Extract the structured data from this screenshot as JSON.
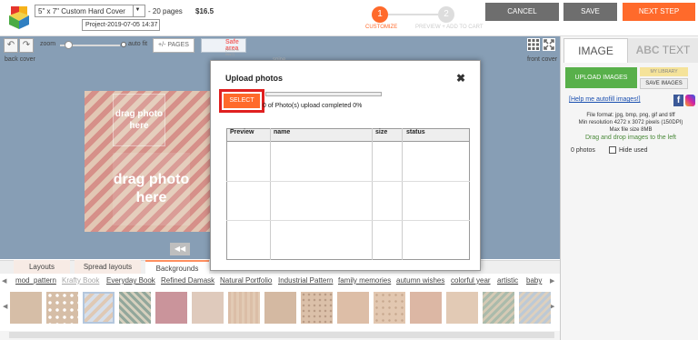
{
  "app": {
    "name": "Pinder's Studio"
  },
  "header": {
    "size_select": "5\" x 7\" Custom Hard Cover",
    "pages": "- 20 pages",
    "price": "$16.5",
    "project_name": "Project-2019-07-05 14:37",
    "steps": [
      {
        "number": "1",
        "label": "CUSTOMIZE"
      },
      {
        "number": "2",
        "label": "PREVIEW + ADD TO CART"
      }
    ],
    "cancel": "CANCEL",
    "save": "SAVE",
    "next_step": "NEXT STEP"
  },
  "toolbar": {
    "zoom": "zoom",
    "auto_fit": "auto fit",
    "pages_btn": "+/- PAGES",
    "safe_area": "Safe area",
    "safe_area_help": "(What is this?)"
  },
  "canvas": {
    "back_cover": "back cover",
    "front_cover": "front cover",
    "spine": "spine",
    "slot_text_small": "drag photo here",
    "slot_text_big": "drag photo here"
  },
  "bottom_tabs": [
    "Layouts",
    "Spread layouts",
    "Backgrounds"
  ],
  "categories": [
    "mod_pattern",
    "Krafty Book",
    "Everyday Book",
    "Refined Damask",
    "Natural Portfolio",
    "Industrial Pattern",
    "family memories",
    "autumn wishes",
    "colorful year",
    "artistic",
    "baby"
  ],
  "active_category": "Krafty Book",
  "right_panel": {
    "tab_image": "IMAGE",
    "tab_text_abc": "ABC",
    "tab_text": "TEXT",
    "upload_images": "UPLOAD IMAGES",
    "my_library": "MY LIBRARY",
    "save_images": "SAVE IMAGES",
    "help_link": "[Help me autofill images!]",
    "format_line1": "File format: jpg, bmp, png, gif and tiff",
    "format_line2": "Min resolution 4272 x 3072 pixels (150DPI)",
    "format_line3": "Max file size 8MB",
    "drag_drop": "Drag and drop images to the left",
    "photo_count": "0 photos",
    "hide_used": "Hide used"
  },
  "dialog": {
    "title": "Upload photos",
    "close": "✖",
    "select": "SELECT",
    "status": "0 of  Photo(s) upload completed   0%",
    "progress": 0,
    "columns": [
      "Preview",
      "name",
      "size",
      "status"
    ]
  },
  "colors": {
    "accent": "#ff6a2b",
    "canvas_bg": "#5f7e9c",
    "upload_green": "#58b04a",
    "chevron_red": "#c86b62",
    "chevron_tan": "#d8b59b"
  }
}
